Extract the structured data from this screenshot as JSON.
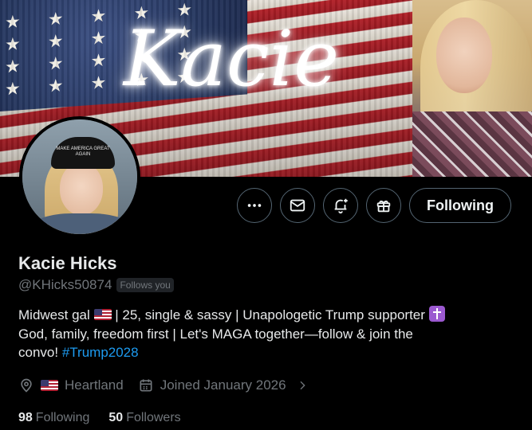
{
  "banner": {
    "script_text": "Kacie"
  },
  "avatar": {
    "cap_text": "MAKE AMERICA GREAT AGAIN"
  },
  "actions": {
    "more_icon": "more-horizontal-icon",
    "message_icon": "envelope-icon",
    "notify_icon": "bell-plus-icon",
    "gift_icon": "gift-icon",
    "follow_label": "Following"
  },
  "profile": {
    "name": "Kacie Hicks",
    "handle": "@KHicks50874",
    "follows_you": "Follows you",
    "bio_line1_a": "Midwest gal",
    "bio_line1_b": "| 25, single & sassy | Unapologetic Trump supporter",
    "bio_line2": "God, family, freedom first | Let's MAGA together—follow & join the",
    "bio_line3": "convo!",
    "hashtag": "#Trump2028",
    "location": "Heartland",
    "joined": "Joined January 2026",
    "following_count": "98",
    "following_label": "Following",
    "followers_count": "50",
    "followers_label": "Followers"
  },
  "colors": {
    "accent": "#1d9bf0",
    "muted": "#71767b",
    "border": "#536471",
    "background": "#000000"
  }
}
